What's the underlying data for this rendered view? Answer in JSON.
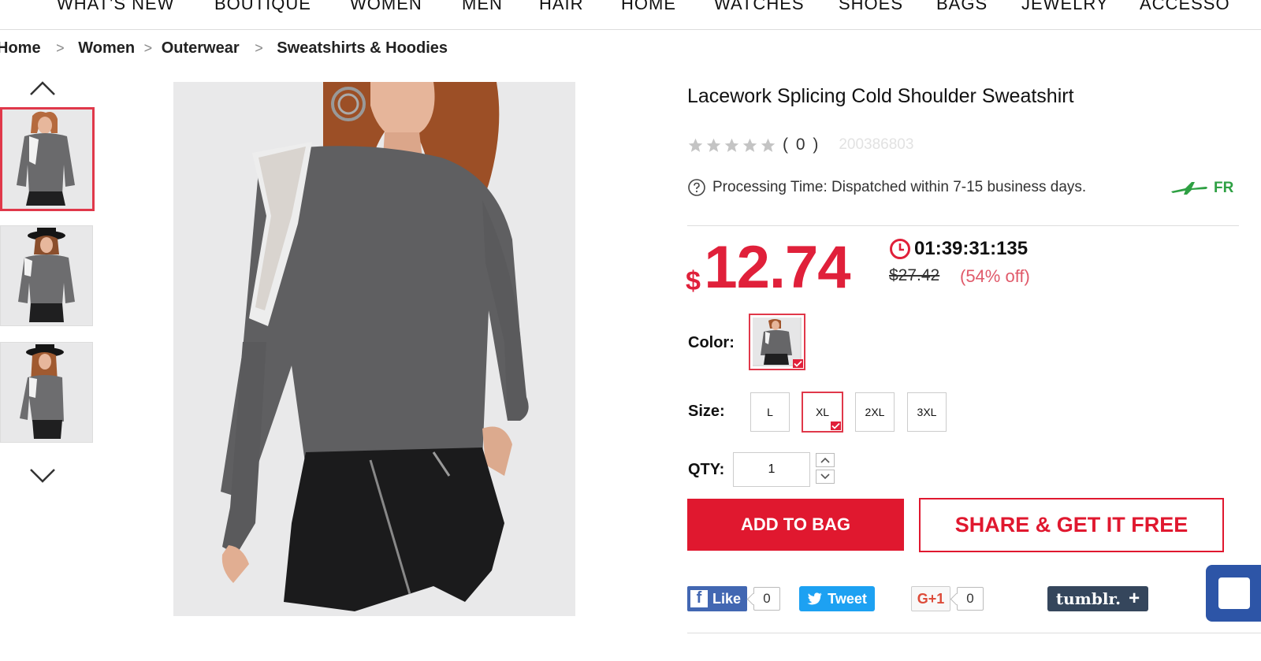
{
  "nav": {
    "items": [
      "WHAT'S NEW",
      "BOUTIQUE",
      "WOMEN",
      "MEN",
      "HAIR",
      "HOME",
      "WATCHES",
      "SHOES",
      "BAGS",
      "JEWELRY",
      "ACCESSO"
    ]
  },
  "breadcrumb": {
    "items": [
      "Home",
      "Women",
      "Outerwear",
      "Sweatshirts & Hoodies"
    ],
    "separator": ">"
  },
  "gallery": {
    "thumbnails": [
      "product-view-1",
      "product-view-2",
      "product-view-3"
    ],
    "active_thumbnail": 0,
    "main_image": "model-in-grey-cold-shoulder-sweatshirt-and-black-leather-skirt"
  },
  "product": {
    "title": "Lacework Splicing Cold Shoulder Sweatshirt",
    "rating_stars": 0,
    "review_count": "( 0 )",
    "sku": "200386803",
    "processing_time": "Processing Time: Dispatched within 7-15 business days.",
    "free_shipping": "FR"
  },
  "pricing": {
    "currency": "$",
    "price": "12.74",
    "countdown": "01:39:31:135",
    "old_price": "$27.42",
    "discount": "(54% off)"
  },
  "options": {
    "color_label": "Color:",
    "size_label": "Size:",
    "sizes": [
      "L",
      "XL",
      "2XL",
      "3XL"
    ],
    "selected_size": "XL",
    "qty_label": "QTY:",
    "qty_value": "1"
  },
  "actions": {
    "add_to_bag": "ADD TO BAG",
    "share": "SHARE & GET IT FREE"
  },
  "social": {
    "fb_like": "Like",
    "fb_count": "0",
    "tweet": "Tweet",
    "gplus": "G+1",
    "gplus_count": "0",
    "tumblr": "tumblr."
  },
  "colors": {
    "accent": "#e0182f",
    "facebook": "#4267b2",
    "twitter": "#1da1f2",
    "tumblr": "#35465c",
    "free_ship": "#2ea043"
  }
}
